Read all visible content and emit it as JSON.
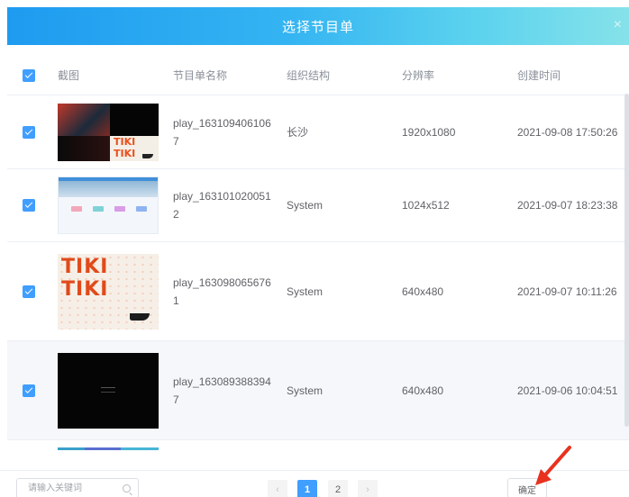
{
  "dialog": {
    "title": "选择节目单",
    "close_glyph": "×"
  },
  "table": {
    "columns": [
      "截图",
      "节目单名称",
      "组织结构",
      "分辨率",
      "创建时间"
    ],
    "rows": [
      {
        "checked": true,
        "thumb": "thumbnail-1",
        "name": "play_1631094061067",
        "org": "长沙",
        "resolution": "1920x1080",
        "created": "2021-09-08 17:50:26"
      },
      {
        "checked": true,
        "thumb": "thumbnail-2",
        "name": "play_1631010200512",
        "org": "System",
        "resolution": "1024x512",
        "created": "2021-09-07 18:23:38"
      },
      {
        "checked": true,
        "thumb": "thumbnail-3",
        "name": "play_1630980656761",
        "org": "System",
        "resolution": "640x480",
        "created": "2021-09-07 10:11:26"
      },
      {
        "checked": true,
        "thumb": "thumbnail-4",
        "name": "play_1630893883947",
        "org": "System",
        "resolution": "640x480",
        "created": "2021-09-06 10:04:51"
      }
    ]
  },
  "footer": {
    "search_placeholder": "请输入关键词",
    "search_icon": "search-icon",
    "pages": [
      "1",
      "2"
    ],
    "current_page": "1",
    "prev_glyph": "‹",
    "next_glyph": "›",
    "confirm_label": "确定"
  },
  "colors": {
    "primary": "#409eff",
    "header_gradient_start": "#1e9bf0",
    "header_gradient_end": "#86e2ea",
    "annotation_arrow": "#e8321f"
  }
}
